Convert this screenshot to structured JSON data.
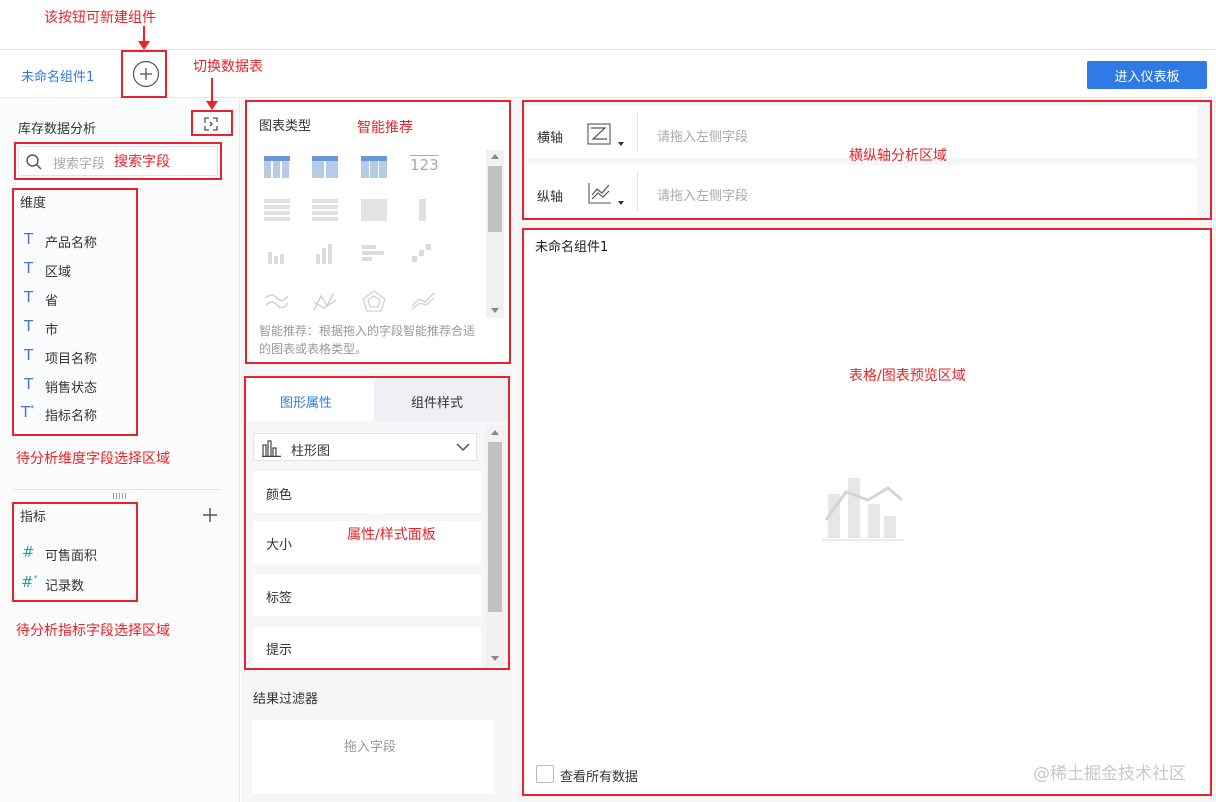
{
  "annotations": {
    "new_component": "该按钮可新建组件",
    "switch_table": "切换数据表",
    "search_field": "搜索字段",
    "smart_recommend": "智能推荐",
    "axis_area": "横纵轴分析区域",
    "preview_area": "表格/图表预览区域",
    "dimension_area": "待分析维度字段选择区域",
    "property_panel": "属性/样式面板",
    "metric_area": "待分析指标字段选择区域"
  },
  "topbar": {
    "tab_label": "未命名组件1",
    "enter_dashboard": "进入仪表板"
  },
  "sidebar": {
    "dataset_name": "库存数据分析",
    "search_placeholder": "搜索字段",
    "dimension_title": "维度",
    "dimensions": [
      "产品名称",
      "区域",
      "省",
      "市",
      "项目名称",
      "销售状态",
      "指标名称"
    ],
    "metric_title": "指标",
    "metrics": [
      "可售面积",
      "记录数"
    ]
  },
  "chart_types": {
    "title": "图表类型",
    "hint": "智能推荐：根据拖入的字段智能推荐合适的图表或表格类型。"
  },
  "props": {
    "tab_shape": "图形属性",
    "tab_style": "组件样式",
    "chart_select": "柱形图",
    "items": [
      "颜色",
      "大小",
      "标签",
      "提示"
    ]
  },
  "filter": {
    "title": "结果过滤器",
    "drop_hint": "拖入字段"
  },
  "axes": {
    "x_label": "横轴",
    "y_label": "纵轴",
    "placeholder": "请拖入左侧字段"
  },
  "preview": {
    "title": "未命名组件1",
    "view_all": "查看所有数据"
  },
  "watermark": "@稀土掘金技术社区",
  "colors": {
    "accent": "#2f7ae5",
    "annotation": "#e8232b",
    "field_text_icon": "#4a74c9",
    "metric_icon": "#2aa69a"
  }
}
